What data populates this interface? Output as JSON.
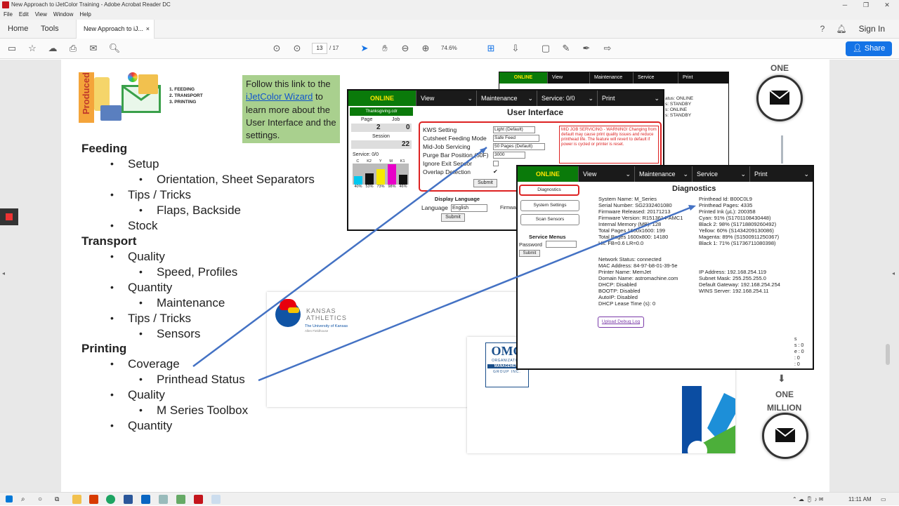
{
  "window": {
    "title": "New Approach to iJetColor Training - Adobe Acrobat Reader DC"
  },
  "menubar": [
    "File",
    "Edit",
    "View",
    "Window",
    "Help"
  ],
  "tabs": {
    "home": "Home",
    "tools": "Tools",
    "doc": "New Approach to iJ...",
    "close": "×",
    "signin": "Sign In"
  },
  "toolbar": {
    "page_current": "13",
    "page_total": "/ 17",
    "zoom": "74.6%",
    "share": "Share"
  },
  "slide": {
    "logo_vertical": "Produced",
    "logo_list": [
      "1.  FEEDING",
      "2.  TRANSPORT",
      "3.  PRINTING"
    ],
    "callout": {
      "pre": "Follow this link to the ",
      "link": "iJetColor Wizard",
      "post": " to learn more about the User Interface and the settings."
    },
    "outline": {
      "feeding": "Feeding",
      "setup": "Setup",
      "orientation": "Orientation, Sheet Separators",
      "tips1": "Tips / Tricks",
      "flaps": "Flaps, Backside",
      "stock": "Stock",
      "transport": "Transport",
      "quality1": "Quality",
      "speed": "Speed, Profiles",
      "quantity1": "Quantity",
      "maintenance": "Maintenance",
      "tips2": "Tips / Tricks",
      "sensors": "Sensors",
      "printing": "Printing",
      "coverage": "Coverage",
      "printhead": "Printhead Status",
      "quality2": "Quality",
      "toolbox": "M Series Toolbox",
      "quantity2": "Quantity"
    },
    "right_labels": {
      "one": "ONE",
      "one2": "ONE",
      "million": "MILLION"
    }
  },
  "ui_window": {
    "online": "ONLINE",
    "view": "View",
    "maintenance": "Maintenance",
    "service": "Service:  0/0",
    "print": "Print",
    "title": "User Interface",
    "file": "Thanksgiving.cdr",
    "page_label": "Page",
    "job_label": "Job",
    "page_val": "2",
    "job_val": "0",
    "session_label": "Session",
    "session_val": "22",
    "ink_labels": [
      "C",
      "K2",
      "Y",
      "M",
      "K1"
    ],
    "ink_pct": [
      "40%",
      "53%",
      "73%",
      "98%",
      "46%"
    ],
    "settings": [
      {
        "label": "KWS Setting",
        "value": "Light (Default)"
      },
      {
        "label": "Cutsheet Feeding Mode",
        "value": "Safe Feed"
      },
      {
        "label": "Mid-Job Servicing",
        "value": "50 Pages (Default)"
      },
      {
        "label": "Purge Bar Position (50F)",
        "value": "3000"
      },
      {
        "label": "Ignore Exit Sensor",
        "value": ""
      },
      {
        "label": "Overlap Detection",
        "value": "✔"
      }
    ],
    "warning": "MID JOB SERVICING - WARNING! Changing from default may cause print quality issues and reduce printhead life. The feature will revert to default if power is cycled or printer is reset.",
    "submit": "Submit",
    "display_language": "Display Language",
    "language_label": "Language",
    "language_value": "English",
    "firmware": "Firmwa"
  },
  "back_window": {
    "online": "ONLINE",
    "view": "View",
    "maintenance": "Maintenance",
    "service": "Service",
    "print": "Print",
    "status": [
      "atus: ONLINE",
      "s: STANDBY",
      "s: ONLINE",
      "s: STANDBY"
    ]
  },
  "diag_window": {
    "online": "ONLINE",
    "view": "View",
    "maintenance": "Maintenance",
    "service": "Service",
    "print": "Print",
    "title": "Diagnostics",
    "buttons": [
      "Diagnostics",
      "System Settings",
      "Scan Sensors"
    ],
    "service_menus": "Service Menus",
    "password": "Password",
    "submit": "Submit",
    "left": [
      "System Name: M_Series",
      "Serial Number: SG2332401080",
      "Firmware Released: 20171213",
      "Firmware Version: R1513614-AMC1",
      "Internal Memory (MB): 128",
      "Total Pages 1600x1600: 199",
      "Total Pages 1600x800: 14180",
      "Hit: FB=0.6 LR=0.0"
    ],
    "right": [
      "Printhead Id: B00C0L9",
      "Printhead Pages: 4335",
      "Printed Ink (µL): 200358",
      "Cyan: 91% (S1701108430448)",
      "Black 2: 98% (S1718809260492)",
      "Yellow: 60% (S1434209130086)",
      "Magenta: 89% (S1500911250367)",
      "Black 1: 71% (S1736711080398)"
    ],
    "network": [
      "Network Status: connected",
      "MAC Address: 84-97-b8-01-39-5e",
      "Printer Name: MemJet",
      "Domain Name: astromachine.com",
      "DHCP: Disabled",
      "BOOTP: Disabled",
      "AutoIP: Disabled",
      "DHCP Lease Time (s): 0"
    ],
    "network_right": [
      "IP Address: 192.168.254.119",
      "Subnet Mask: 255.255.255.0",
      "Default Gateway: 192.168.254.254",
      "WINS Server: 192.168.254.11"
    ],
    "upload": "Upload Debug Log",
    "partial": [
      "s",
      "s : 0",
      "e : 0",
      ": 0",
      ": 0"
    ]
  },
  "envelope1": {
    "brand": "KANSAS",
    "brand2": "ATHLETICS",
    "sub": "The University of Kansas",
    "addr": "Allen Fieldhouse"
  },
  "envelope2": {
    "omg": "OMG",
    "org1": "ORGANIZATION",
    "org2": "MANAGEMENT",
    "org3": "GROUP INC."
  },
  "taskbar": {
    "time": "11:11 AM"
  }
}
